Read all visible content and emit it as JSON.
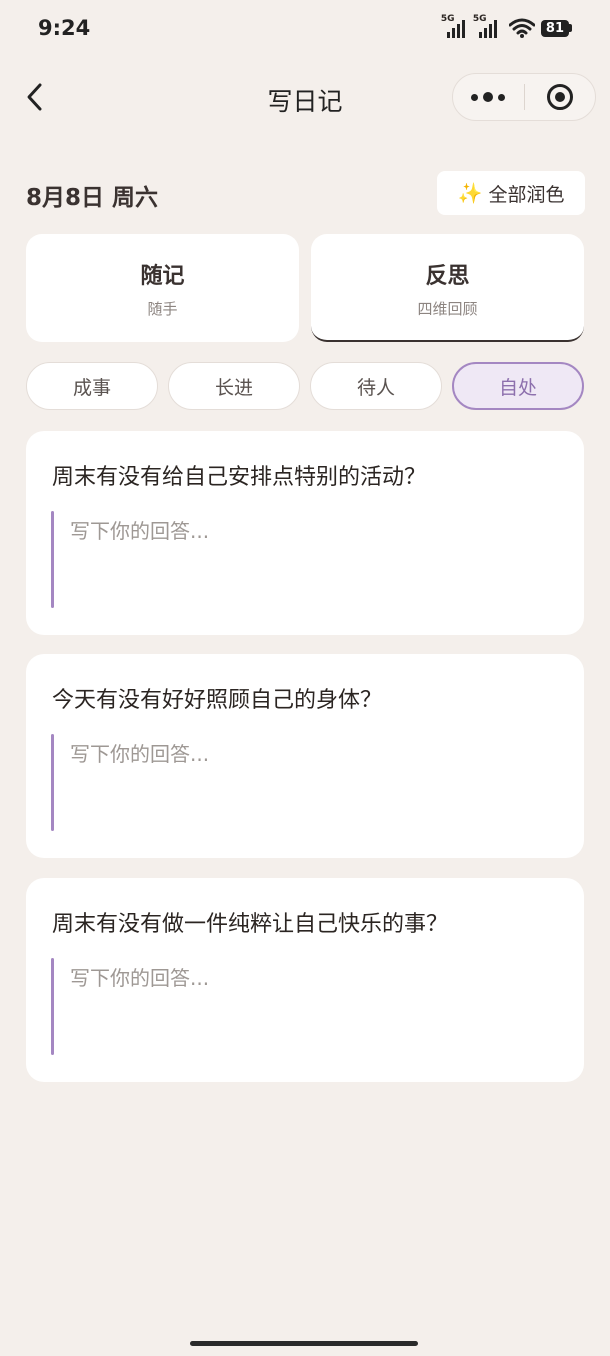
{
  "status_bar": {
    "time": "9:24",
    "network_1": "5G",
    "network_2": "5G",
    "battery": "81"
  },
  "nav": {
    "title": "写日记"
  },
  "date_label": "8月8日 周六",
  "polish_button": {
    "icon": "✨",
    "label": "全部润色"
  },
  "modes": [
    {
      "title": "随记",
      "subtitle": "随手",
      "active": false
    },
    {
      "title": "反思",
      "subtitle": "四维回顾",
      "active": true
    }
  ],
  "categories": [
    {
      "label": "成事",
      "active": false
    },
    {
      "label": "长进",
      "active": false
    },
    {
      "label": "待人",
      "active": false
    },
    {
      "label": "自处",
      "active": true
    }
  ],
  "questions": [
    {
      "text": "周末有没有给自己安排点特别的活动？",
      "placeholder": "写下你的回答...",
      "answer": ""
    },
    {
      "text": "今天有没有好好照顾自己的身体？",
      "placeholder": "写下你的回答...",
      "answer": ""
    },
    {
      "text": "周末有没有做一件纯粹让自己快乐的事？",
      "placeholder": "写下你的回答...",
      "answer": ""
    }
  ],
  "colors": {
    "background": "#f4efeb",
    "accent": "#a487c2",
    "accent_bg": "#efe8f5",
    "sparkle": "#f1b72a"
  }
}
